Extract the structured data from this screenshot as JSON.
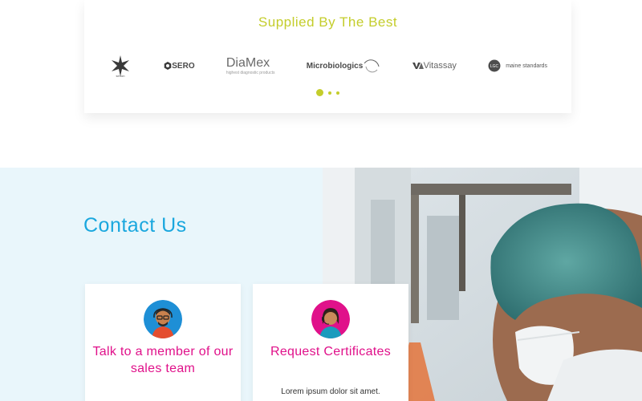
{
  "suppliers": {
    "title": "Supplied By The Best",
    "logos": [
      {
        "name": "Serion",
        "text": "serion"
      },
      {
        "name": "Sero",
        "text": "SERO"
      },
      {
        "name": "DiaMex",
        "text": "DiaMex",
        "subtext": "highest diagnostic products"
      },
      {
        "name": "Microbiologics",
        "text": "Microbiologics"
      },
      {
        "name": "Vitassay",
        "text": "Vitassay"
      },
      {
        "name": "LGC Maine Standards",
        "text": "maine standards",
        "badge": "LGC"
      }
    ],
    "carousel_pages": 3,
    "active_page": 1
  },
  "contact": {
    "title": "Contact Us",
    "cards": [
      {
        "title": "Talk to a member of our sales team",
        "text": ""
      },
      {
        "title": "Request Certificates",
        "text": "Lorem ipsum dolor sit amet."
      }
    ]
  },
  "colors": {
    "accent_lime": "#c4cd2b",
    "accent_blue": "#1aa7de",
    "accent_magenta": "#e0118a",
    "section_bg": "#e9f6fb"
  }
}
